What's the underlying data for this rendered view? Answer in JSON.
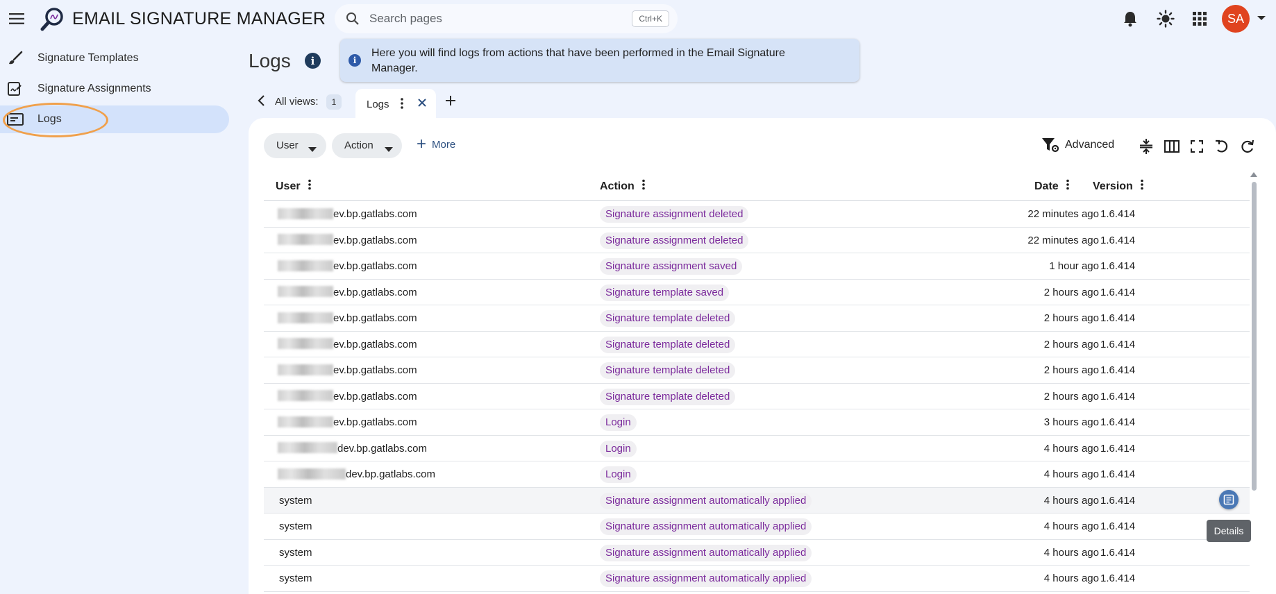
{
  "app": {
    "title": "EMAIL SIGNATURE MANAGER",
    "search_placeholder": "Search pages",
    "search_shortcut": "Ctrl+K",
    "avatar_initials": "SA",
    "accent_color": "#e0431f"
  },
  "sidebar": {
    "items": [
      {
        "label": "Signature Templates",
        "icon": "brush-icon",
        "active": false
      },
      {
        "label": "Signature Assignments",
        "icon": "signature-icon",
        "active": false
      },
      {
        "label": "Logs",
        "icon": "log-icon",
        "active": true
      }
    ]
  },
  "page": {
    "title": "Logs",
    "banner_text": "Here you will find logs from actions that have been performed in the Email Signature Manager."
  },
  "views": {
    "label": "All views:",
    "count": "1",
    "active_tab": "Logs"
  },
  "filters": {
    "user": "User",
    "action": "Action",
    "more": "More",
    "advanced": "Advanced"
  },
  "table": {
    "columns": [
      "User",
      "Action",
      "Date",
      "Version"
    ],
    "rows": [
      {
        "user": "ev.bp.gatlabs.com",
        "action": "Signature assignment deleted",
        "date": "22 minutes ago",
        "version": "1.6.414"
      },
      {
        "user": "ev.bp.gatlabs.com",
        "action": "Signature assignment deleted",
        "date": "22 minutes ago",
        "version": "1.6.414"
      },
      {
        "user": "ev.bp.gatlabs.com",
        "action": "Signature assignment saved",
        "date": "1 hour ago",
        "version": "1.6.414"
      },
      {
        "user": "ev.bp.gatlabs.com",
        "action": "Signature template saved",
        "date": "2 hours ago",
        "version": "1.6.414"
      },
      {
        "user": "ev.bp.gatlabs.com",
        "action": "Signature template deleted",
        "date": "2 hours ago",
        "version": "1.6.414"
      },
      {
        "user": "ev.bp.gatlabs.com",
        "action": "Signature template deleted",
        "date": "2 hours ago",
        "version": "1.6.414"
      },
      {
        "user": "ev.bp.gatlabs.com",
        "action": "Signature template deleted",
        "date": "2 hours ago",
        "version": "1.6.414"
      },
      {
        "user": "ev.bp.gatlabs.com",
        "action": "Signature template deleted",
        "date": "2 hours ago",
        "version": "1.6.414"
      },
      {
        "user": "ev.bp.gatlabs.com",
        "action": "Login",
        "date": "3 hours ago",
        "version": "1.6.414"
      },
      {
        "user": "dev.bp.gatlabs.com",
        "action": "Login",
        "date": "4 hours ago",
        "version": "1.6.414"
      },
      {
        "user": "dev.bp.gatlabs.com",
        "action": "Login",
        "date": "4 hours ago",
        "version": "1.6.414"
      },
      {
        "user": "system",
        "action": "Signature assignment automatically applied",
        "date": "4 hours ago",
        "version": "1.6.414"
      },
      {
        "user": "system",
        "action": "Signature assignment automatically applied",
        "date": "4 hours ago",
        "version": "1.6.414"
      },
      {
        "user": "system",
        "action": "Signature assignment automatically applied",
        "date": "4 hours ago",
        "version": "1.6.414"
      },
      {
        "user": "system",
        "action": "Signature assignment automatically applied",
        "date": "4 hours ago",
        "version": "1.6.414"
      }
    ],
    "details_tooltip": "Details"
  }
}
